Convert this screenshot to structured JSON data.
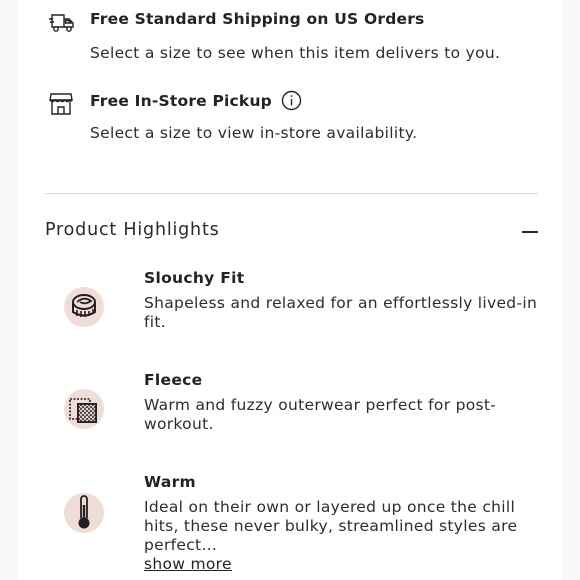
{
  "fulfillment": {
    "shipping": {
      "icon": "delivery-truck-icon",
      "title": "Free Standard Shipping on US Orders",
      "description": "Select a size to see when this item delivers to you."
    },
    "pickup": {
      "icon": "storefront-icon",
      "title": "Free In-Store Pickup",
      "info_icon": "info-icon",
      "description": "Select a size to view in-store availability."
    }
  },
  "product_highlights": {
    "title": "Product Highlights",
    "collapse_icon": "minus-icon",
    "items": [
      {
        "icon": "slouchy-fit-icon",
        "title": "Slouchy Fit",
        "description": "Shapeless and relaxed for an effortlessly lived-in fit."
      },
      {
        "icon": "fleece-icon",
        "title": "Fleece",
        "description": "Warm and fuzzy outerwear perfect for post-workout."
      },
      {
        "icon": "thermometer-icon",
        "title": "Warm",
        "description": "Ideal on their own or layered up once the chill hits, these never bulky, streamlined styles are perfect...",
        "show_more": "show more"
      }
    ]
  },
  "colors": {
    "badge": "#f0ddd7",
    "text": "#232323",
    "divider": "#d9d9d9"
  }
}
